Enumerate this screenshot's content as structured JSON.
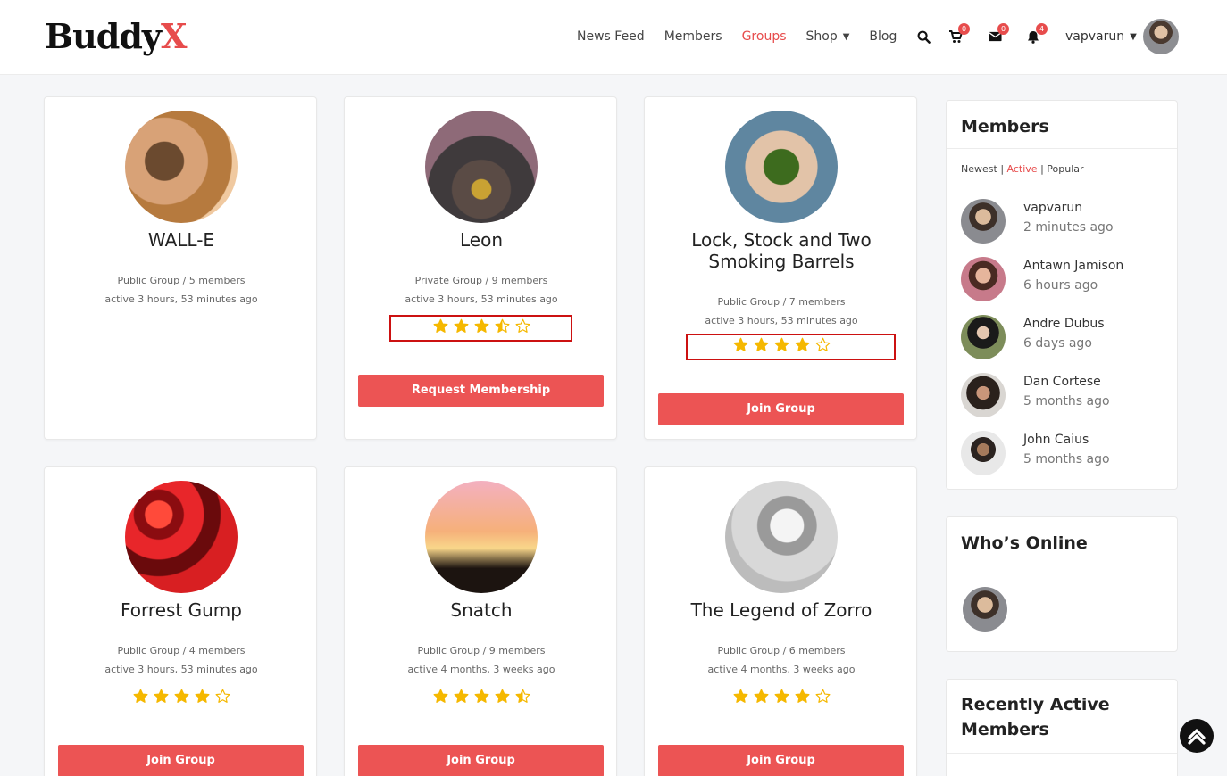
{
  "brand": {
    "name_main": "Buddy",
    "name_accent": "X",
    "accent_color": "#e74c4c"
  },
  "nav": {
    "news_feed": "News Feed",
    "members": "Members",
    "groups": "Groups",
    "shop": "Shop",
    "blog": "Blog"
  },
  "header": {
    "cart_count": "0",
    "messages_count": "0",
    "notifications_count": "4",
    "username": "vapvarun"
  },
  "groups": [
    {
      "name": "WALL-E",
      "meta": "Public Group / 5 members",
      "activity": "active 3 hours, 53 minutes ago"
    },
    {
      "name": "Leon",
      "meta": "Private Group / 9 members",
      "activity": "active 3 hours, 53 minutes ago",
      "rating": 3.5,
      "button": "Request Membership"
    },
    {
      "name_line1": "Lock, Stock and Two",
      "name_line2": "Smoking Barrels",
      "meta": "Public Group / 7 members",
      "activity": "active 3 hours, 53 minutes ago",
      "rating": 4,
      "button": "Join Group"
    },
    {
      "name": "Forrest Gump",
      "meta": "Public Group / 4 members",
      "activity": "active 3 hours, 53 minutes ago",
      "rating": 4,
      "button": "Join Group"
    },
    {
      "name": "Snatch",
      "meta": "Public Group / 9 members",
      "activity": "active 4 months, 3 weeks ago",
      "rating": 4.5,
      "button": "Join Group"
    },
    {
      "name": "The Legend of Zorro",
      "meta": "Public Group / 6 members",
      "activity": "active 4 months, 3 weeks ago",
      "rating": 4,
      "button": "Join Group"
    }
  ],
  "sidebar": {
    "members_widget": {
      "title": "Members",
      "filter_newest": "Newest",
      "filter_active": "Active",
      "filter_popular": "Popular",
      "separator": "|",
      "members": [
        {
          "name": "vapvarun",
          "time": "2 minutes ago"
        },
        {
          "name": "Antawn Jamison",
          "time": "6 hours ago"
        },
        {
          "name": "Andre Dubus",
          "time": "6 days ago"
        },
        {
          "name": "Dan Cortese",
          "time": "5 months ago"
        },
        {
          "name": "John Caius",
          "time": "5 months ago"
        }
      ]
    },
    "whos_online": {
      "title": "Who’s Online"
    },
    "recently_active": {
      "title_line1": "Recently Active",
      "title_line2": "Members"
    }
  },
  "colors": {
    "button": "#ec5454",
    "star": "#f5b800",
    "highlight_box": "#cc1111"
  }
}
